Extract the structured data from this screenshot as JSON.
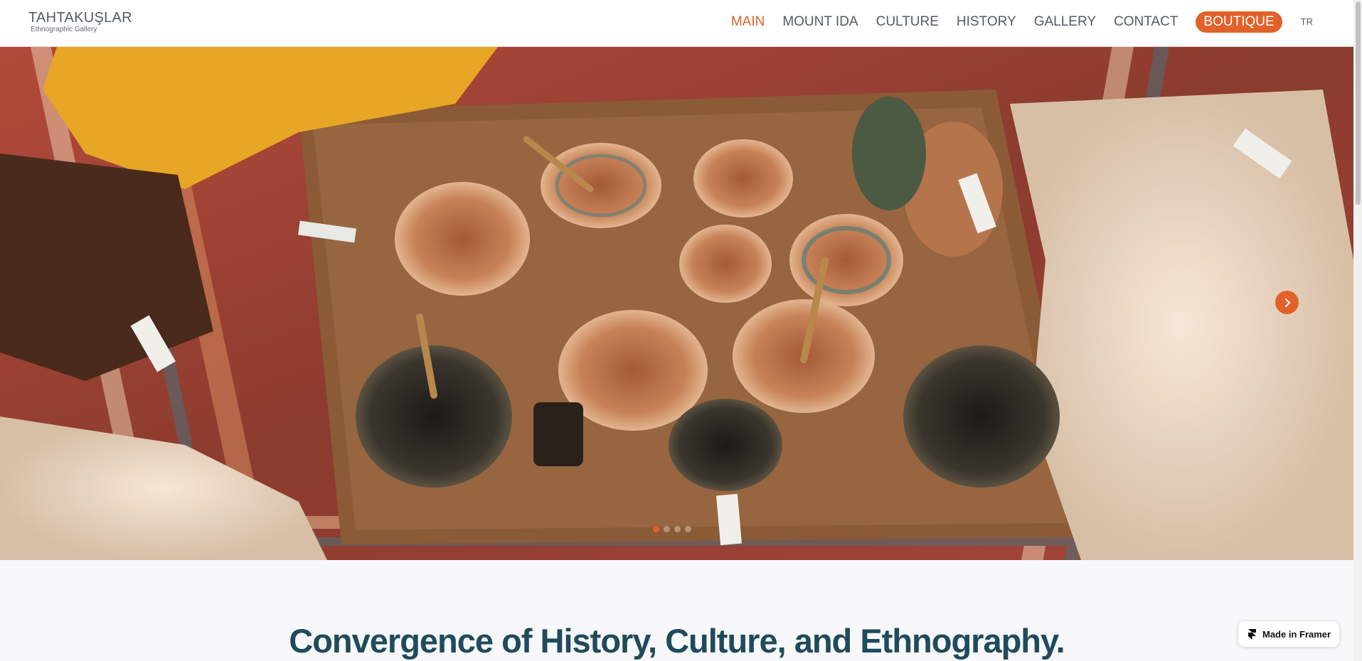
{
  "header": {
    "logo_title": "TAHTAKUŞLAR",
    "logo_subtitle": "Ethnographic Gallery",
    "nav": [
      {
        "label": "MAIN",
        "active": true
      },
      {
        "label": "MOUNT IDA",
        "active": false
      },
      {
        "label": "CULTURE",
        "active": false
      },
      {
        "label": "HISTORY",
        "active": false
      },
      {
        "label": "GALLERY",
        "active": false
      },
      {
        "label": "CONTACT",
        "active": false
      }
    ],
    "boutique_label": "BOUTIQUE",
    "language_label": "TR"
  },
  "hero": {
    "image_icon": "photo-of-pottery-bowls-on-rugs",
    "next_icon": "chevron-right-icon",
    "slide_count": 4,
    "active_slide": 1
  },
  "main": {
    "section_title": "Convergence of History, Culture, and Ethnography."
  },
  "badge": {
    "label": "Made in Framer",
    "icon": "framer-logo-icon"
  },
  "colors": {
    "accent": "#e0622a",
    "heading": "#1f4b5c",
    "nav_text": "#555b63",
    "section_bg": "#f8f8fa"
  }
}
